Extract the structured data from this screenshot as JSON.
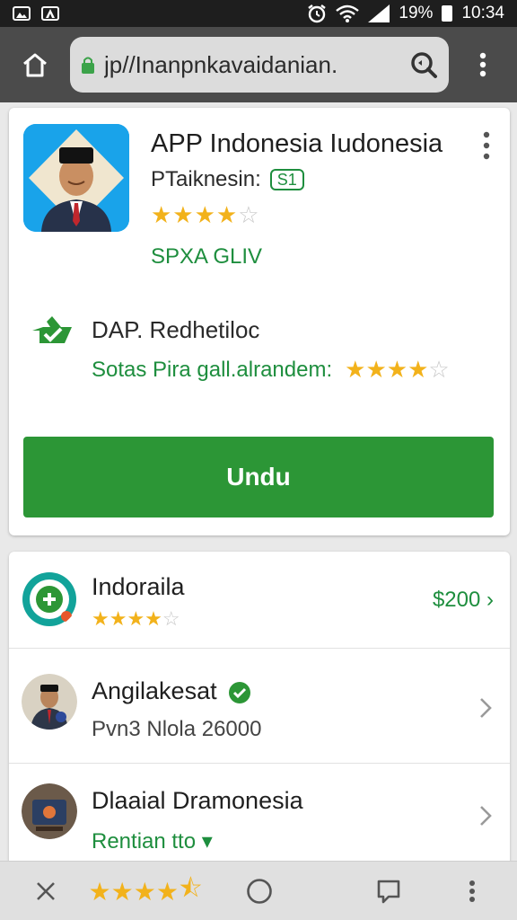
{
  "status_bar": {
    "left_icons": [
      "image-notification-icon",
      "store-notification-icon"
    ],
    "alarm_icon": "alarm-icon",
    "wifi_icon": "wifi-icon",
    "signal_icon": "signal-icon",
    "battery_percent": "19%",
    "time": "10:34"
  },
  "browser": {
    "home_icon": "home-icon",
    "url": "jp//Inanpnkavaidanian.",
    "lock_icon": "lock-icon",
    "search_icon": "search-icon",
    "menu_icon": "more-vert-icon"
  },
  "app": {
    "title": "APP Indonesia Iudonesia",
    "developer": "PTaiknesin:",
    "developer_badge": "S1",
    "rating_stars": 4,
    "rating_display": "★★★★",
    "rating_empty": "☆",
    "price_label": "SPXA GLIV",
    "permission_title": "DAP. Redhetiloc",
    "permission_subtitle": "Sotas Pira gall.alrandem:",
    "permission_stars": 4,
    "permission_stars_display": "★★★★",
    "permission_stars_empty": "☆",
    "install_label": "Undu"
  },
  "list": {
    "items": [
      {
        "title": "Indoraila",
        "stars_display": "★★★★",
        "stars_empty": "☆",
        "stars": 4,
        "price": "$200",
        "price_chevron": "›"
      },
      {
        "title": "Angilakesat",
        "verified_icon": "verified-check-icon",
        "subtitle": "Pvn3 Nlola 26000"
      },
      {
        "title": "Dlaaial Dramonesia",
        "subtitle": "Rentian tto",
        "subtitle_suffix": "▾"
      }
    ]
  },
  "bottom_nav": {
    "close_icon": "close-icon",
    "stars_display": "★★★★",
    "stars_half": "⯪",
    "stars": 4.5,
    "home_circle_icon": "circle-home-icon",
    "recents_icon": "recents-square-icon",
    "more_icon": "more-vert-icon"
  },
  "colors": {
    "accent_green": "#2c9636",
    "text_green": "#1e8e3e",
    "star_gold": "#f2b21b",
    "status_bar": "#1e1e1e",
    "browser_bar": "#4b4b4b",
    "app_icon_blue": "#19a3ea"
  }
}
